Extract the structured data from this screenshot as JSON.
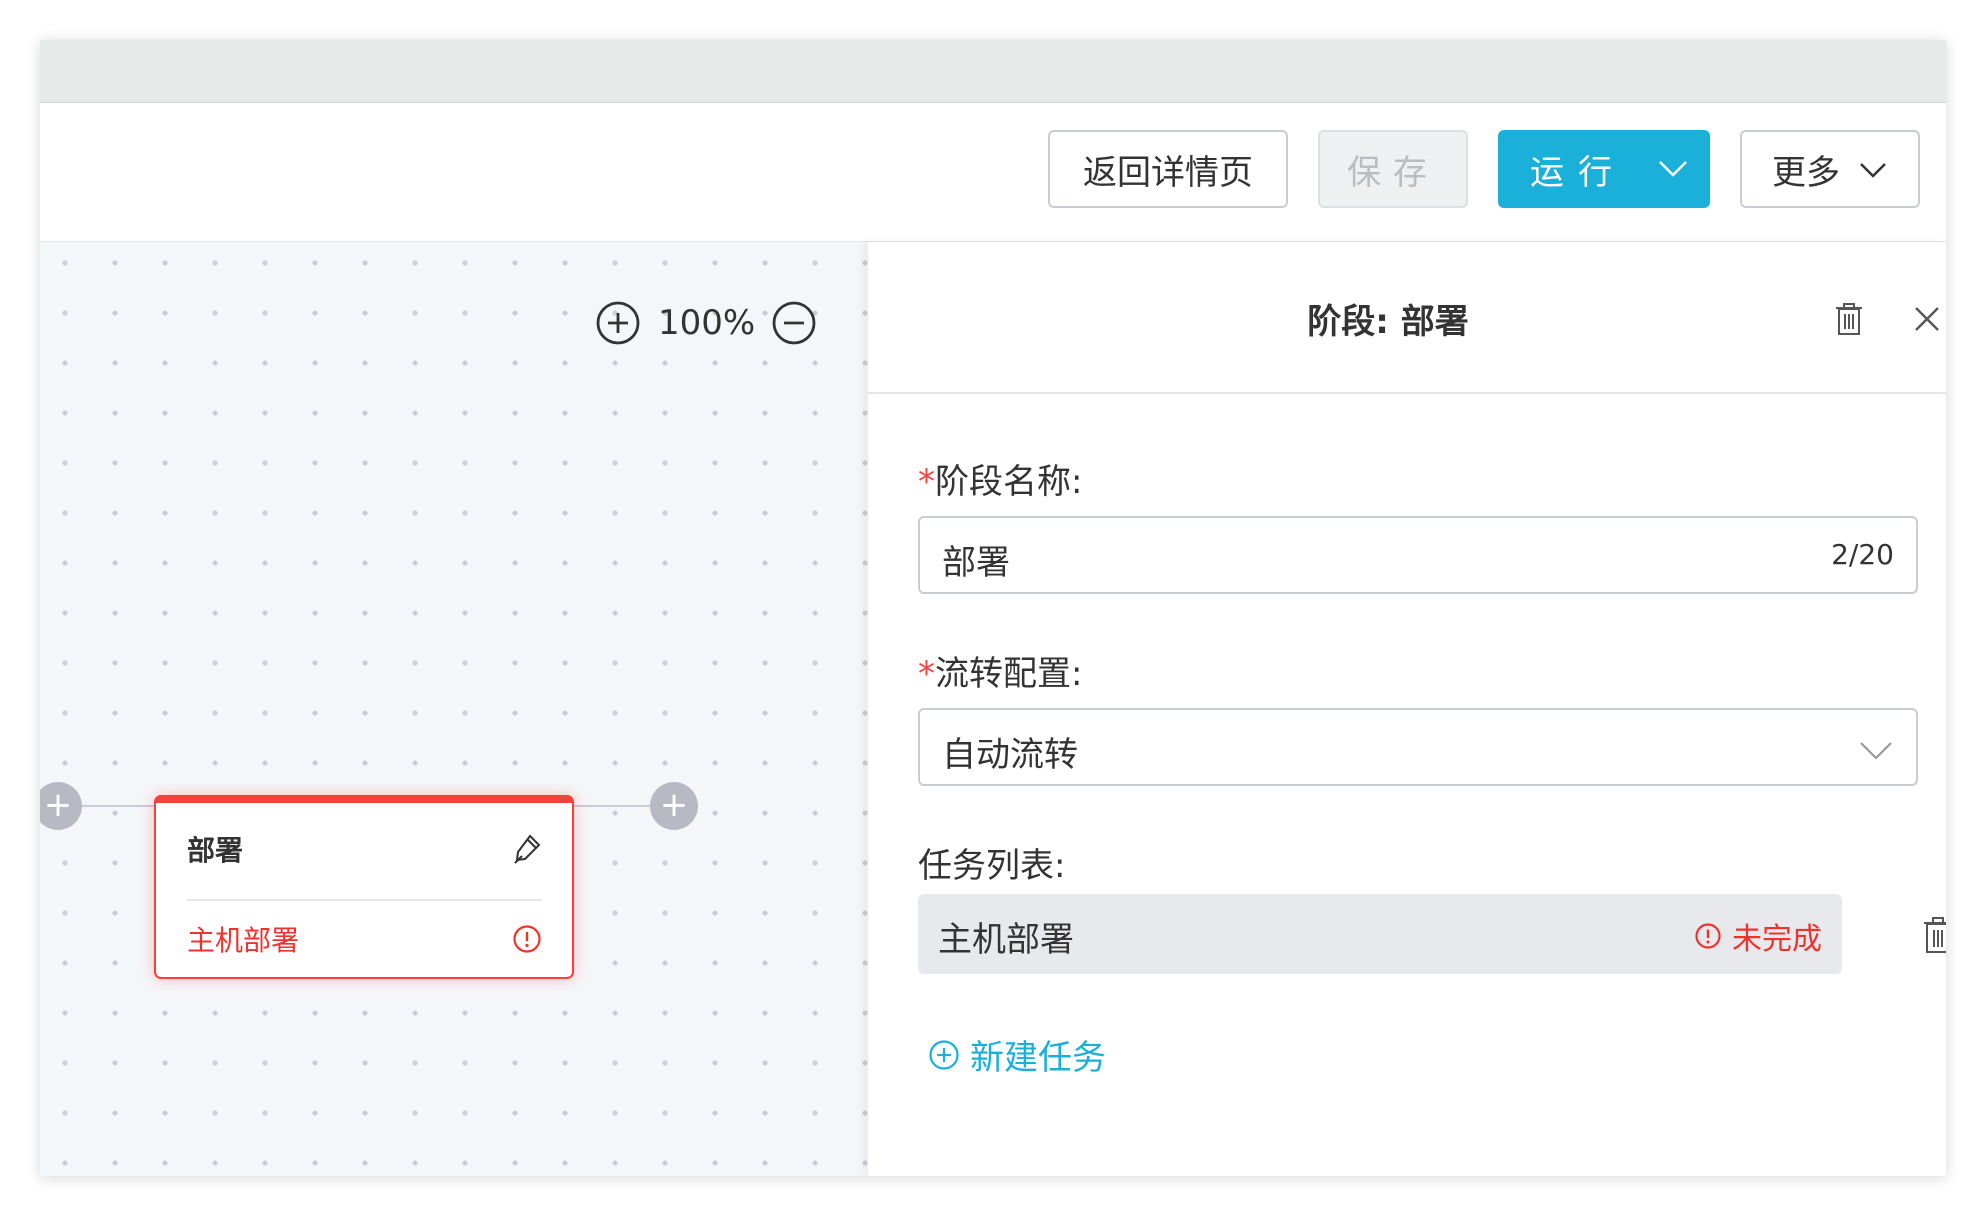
{
  "toolbar": {
    "back_label": "返回详情页",
    "save_label": "保存",
    "run_label": "运行",
    "more_label": "更多"
  },
  "canvas": {
    "zoom_level": "100%",
    "stage_card": {
      "title": "部署",
      "task": "主机部署"
    }
  },
  "panel": {
    "title": "阶段: 部署",
    "stage_name": {
      "label": "阶段名称:",
      "value": "部署",
      "counter": "2/20"
    },
    "flow_config": {
      "label": "流转配置:",
      "value": "自动流转"
    },
    "task_list": {
      "label": "任务列表:",
      "tasks": [
        {
          "name": "主机部署",
          "status": "未完成"
        }
      ]
    },
    "new_task_label": "新建任务"
  },
  "colors": {
    "accent": "#1ab0da",
    "error": "#f0322d",
    "canvas_bg": "#f5f6f9"
  },
  "icons": [
    "plus-circle-icon",
    "minus-circle-icon",
    "edit-icon",
    "alert-circle-icon",
    "trash-icon",
    "close-icon",
    "chevron-down-icon"
  ]
}
